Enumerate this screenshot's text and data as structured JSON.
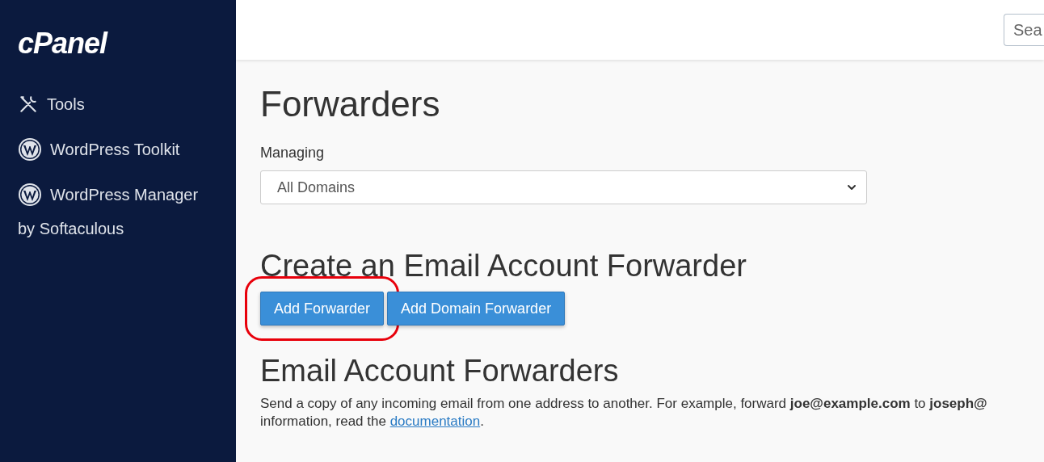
{
  "sidebar": {
    "logo": "cPanel",
    "items": [
      {
        "kind": "tools",
        "label": "Tools"
      },
      {
        "kind": "wordpress",
        "label": "WordPress Toolkit"
      },
      {
        "kind": "wordpress",
        "label": "WordPress Manager",
        "sublabel": "by Softaculous"
      }
    ]
  },
  "header": {
    "search": {
      "placeholder": "Sea"
    }
  },
  "page": {
    "title": "Forwarders",
    "managing": {
      "label": "Managing",
      "value": "All Domains"
    },
    "create_heading": "Create an Email Account Forwarder",
    "buttons": [
      {
        "label": "Add Forwarder",
        "highlighted": true
      },
      {
        "label": "Add Domain Forwarder",
        "highlighted": false
      }
    ],
    "list_heading": "Email Account Forwarders",
    "description": {
      "line_1": "Send a copy of any incoming email from one address to another. For example, forward **joe@example.com** to **joseph@**",
      "line_2": "information, read the",
      "link": "documentation",
      "end": "."
    }
  }
}
